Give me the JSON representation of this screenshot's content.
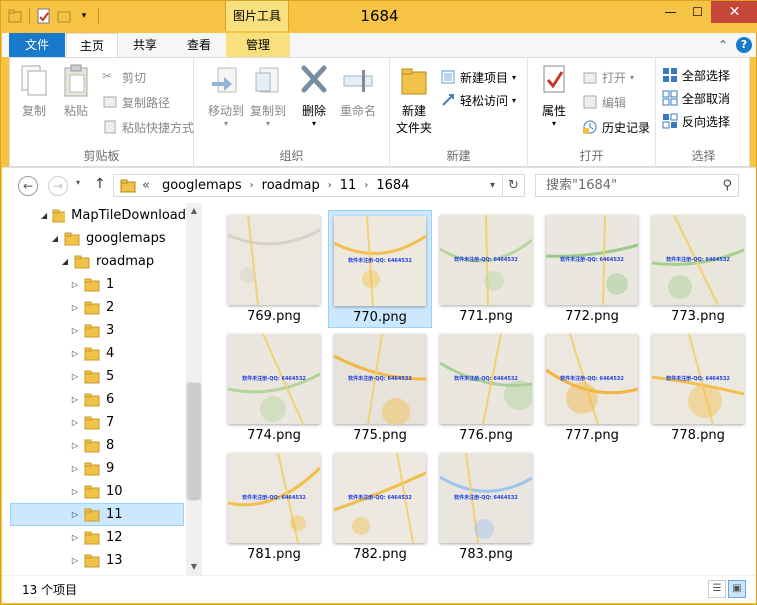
{
  "window": {
    "title": "1684",
    "context_tab_header": "图片工具",
    "controls": {
      "minimize": "—",
      "maximize": "☐",
      "close": "✕"
    }
  },
  "ribbon_tabs": {
    "file": "文件",
    "home": "主页",
    "share": "共享",
    "view": "查看",
    "manage": "管理",
    "collapse": "⌃",
    "help": "?"
  },
  "clipboard": {
    "copy": "复制",
    "paste": "粘贴",
    "cut": "剪切",
    "copy_path": "复制路径",
    "paste_shortcut": "粘贴快捷方式",
    "group": "剪贴板"
  },
  "organize": {
    "move_to": "移动到",
    "copy_to": "复制到",
    "delete": "删除",
    "rename": "重命名",
    "group": "组织"
  },
  "new": {
    "new_folder_line1": "新建",
    "new_folder_line2": "文件夹",
    "new_item": "新建项目",
    "easy_access": "轻松访问",
    "group": "新建"
  },
  "open": {
    "properties": "属性",
    "open": "打开",
    "edit": "编辑",
    "history": "历史记录",
    "group": "打开"
  },
  "select": {
    "select_all": "全部选择",
    "select_none": "全部取消",
    "invert": "反向选择",
    "group": "选择"
  },
  "address": {
    "overflow": "«",
    "crumbs": [
      "googlemaps",
      "roadmap",
      "11",
      "1684"
    ],
    "search_placeholder": "搜索\"1684\""
  },
  "tree": [
    {
      "label": "MapTileDownload",
      "level": 0,
      "expanded": true
    },
    {
      "label": "googlemaps",
      "level": 1,
      "expanded": true
    },
    {
      "label": "roadmap",
      "level": 2,
      "expanded": true
    },
    {
      "label": "1",
      "level": 3
    },
    {
      "label": "2",
      "level": 3
    },
    {
      "label": "3",
      "level": 3
    },
    {
      "label": "4",
      "level": 3
    },
    {
      "label": "5",
      "level": 3
    },
    {
      "label": "6",
      "level": 3
    },
    {
      "label": "7",
      "level": 3
    },
    {
      "label": "8",
      "level": 3
    },
    {
      "label": "9",
      "level": 3
    },
    {
      "label": "10",
      "level": 3
    },
    {
      "label": "11",
      "level": 3,
      "selected": true
    },
    {
      "label": "12",
      "level": 3
    },
    {
      "label": "13",
      "level": 3
    }
  ],
  "files": [
    {
      "name": "769.png",
      "watermark": ""
    },
    {
      "name": "770.png",
      "watermark": "软件未注册-QQ: 6464532",
      "selected": true
    },
    {
      "name": "771.png",
      "watermark": "软件未注册-QQ: 6464532"
    },
    {
      "name": "772.png",
      "watermark": "软件未注册-QQ: 6464532"
    },
    {
      "name": "773.png",
      "watermark": "软件未注册-QQ: 6464532"
    },
    {
      "name": "774.png",
      "watermark": "软件未注册-QQ: 6464532"
    },
    {
      "name": "775.png",
      "watermark": "软件未注册-QQ: 6464532"
    },
    {
      "name": "776.png",
      "watermark": "软件未注册-QQ: 6464532"
    },
    {
      "name": "777.png",
      "watermark": "软件未注册-QQ: 6464532"
    },
    {
      "name": "778.png",
      "watermark": "软件未注册-QQ: 6464532"
    },
    {
      "name": "781.png",
      "watermark": "软件未注册-QQ: 6464532"
    },
    {
      "name": "782.png",
      "watermark": "软件未注册-QQ: 6464532"
    },
    {
      "name": "783.png",
      "watermark": "软件未注册-QQ: 6464532"
    }
  ],
  "status": {
    "count": "13 个项目"
  }
}
